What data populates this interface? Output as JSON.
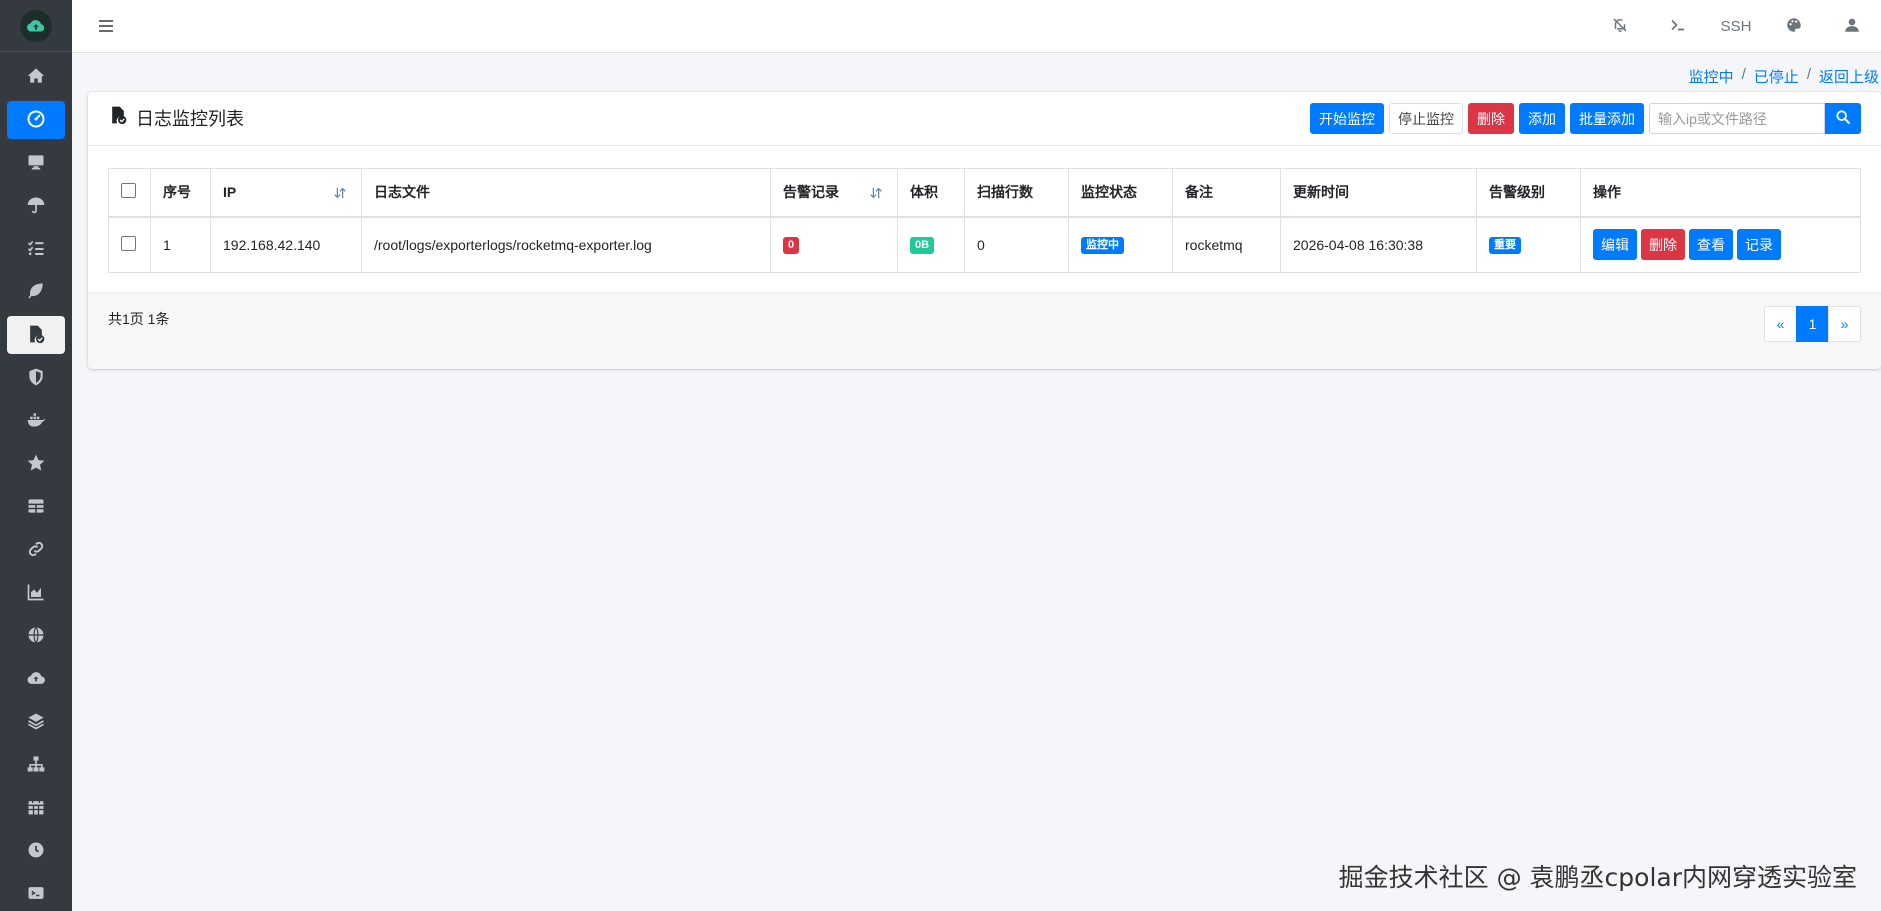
{
  "sidebar": {
    "items": [
      {
        "icon": "home-icon"
      },
      {
        "icon": "dashboard-icon",
        "active": "blue"
      },
      {
        "icon": "monitor-icon"
      },
      {
        "icon": "umbrella-icon"
      },
      {
        "icon": "tasks-icon"
      },
      {
        "icon": "leaf-icon"
      },
      {
        "icon": "file-check-icon",
        "active": "white"
      },
      {
        "icon": "shield-icon"
      },
      {
        "icon": "docker-icon"
      },
      {
        "icon": "star-icon"
      },
      {
        "icon": "table-icon"
      },
      {
        "icon": "link-icon"
      },
      {
        "icon": "area-chart-icon"
      },
      {
        "icon": "globe-icon"
      },
      {
        "icon": "cloud-upload-icon"
      },
      {
        "icon": "layers-icon"
      },
      {
        "icon": "network-icon"
      },
      {
        "icon": "calendar-icon"
      },
      {
        "icon": "clock-icon"
      },
      {
        "icon": "terminal-box-icon"
      }
    ]
  },
  "topbar": {
    "ssh_label": "SSH"
  },
  "breadcrumb": {
    "items": [
      "监控中",
      "已停止",
      "返回上级"
    ],
    "separator": "/"
  },
  "card": {
    "title": "日志监控列表",
    "toolbar": {
      "start": "开始监控",
      "stop": "停止监控",
      "delete": "删除",
      "add": "添加",
      "batch_add": "批量添加",
      "search_placeholder": "输入ip或文件路径"
    }
  },
  "table": {
    "headers": {
      "seq": "序号",
      "ip": "IP",
      "logfile": "日志文件",
      "alerts": "告警记录",
      "size": "体积",
      "lines": "扫描行数",
      "status": "监控状态",
      "remark": "备注",
      "updated": "更新时间",
      "level": "告警级别",
      "ops": "操作"
    },
    "rows": [
      {
        "seq": "1",
        "ip": "192.168.42.140",
        "logfile": "/root/logs/exporterlogs/rocketmq-exporter.log",
        "alerts": "0",
        "size": "0B",
        "lines": "0",
        "status": "监控中",
        "remark": "rocketmq",
        "updated": "2026-04-08 16:30:38",
        "level": "重要",
        "ops": {
          "edit": "编辑",
          "delete": "删除",
          "view": "查看",
          "record": "记录"
        }
      }
    ]
  },
  "pagination": {
    "info": "共1页 1条",
    "prev": "«",
    "current": "1",
    "next": "»"
  },
  "watermark": "掘金技术社区 @ 袁鹏丞cpolar内网穿透实验室",
  "colors": {
    "primary": "#007bff",
    "danger": "#dc3545",
    "success": "#20c997",
    "sidebar_bg": "#343a40"
  }
}
